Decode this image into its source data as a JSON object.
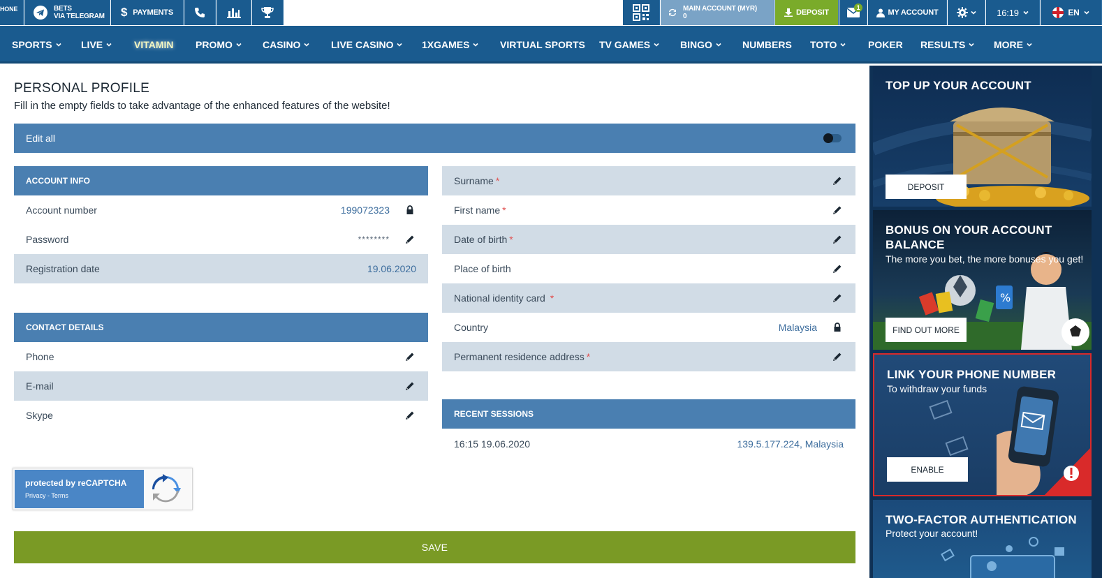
{
  "topbar": {
    "phone_label": "HONE",
    "telegram_line1": "BETS",
    "telegram_line2": "VIA TELEGRAM",
    "payments": "PAYMENTS",
    "main_account_line1": "MAIN ACCOUNT (MYR)",
    "main_account_line2": "0",
    "deposit": "DEPOSIT",
    "mail_badge": "1",
    "my_account": "MY ACCOUNT",
    "time": "16:19",
    "lang": "EN"
  },
  "nav": {
    "items": [
      "SPORTS",
      "LIVE",
      "VITAMIN",
      "PROMO",
      "CASINO",
      "LIVE CASINO",
      "1XGAMES",
      "VIRTUAL SPORTS",
      "TV GAMES",
      "BINGO",
      "NUMBERS",
      "TOTO",
      "POKER",
      "RESULTS",
      "MORE"
    ]
  },
  "profile": {
    "title": "PERSONAL PROFILE",
    "subtitle": "Fill in the empty fields to take advantage of the enhanced features of the website!",
    "edit_all": "Edit all"
  },
  "account_info": {
    "heading": "ACCOUNT INFO",
    "account_number_label": "Account number",
    "account_number": "199072323",
    "password_label": "Password",
    "password": "********",
    "registration_label": "Registration date",
    "registration_date": "19.06.2020"
  },
  "contact": {
    "heading": "CONTACT DETAILS",
    "phone": "Phone",
    "email": "E-mail",
    "skype": "Skype"
  },
  "personal": {
    "surname": "Surname",
    "first_name": "First name",
    "dob": "Date of birth",
    "place_of_birth": "Place of birth",
    "national_id": "National identity card",
    "country_label": "Country",
    "country": "Malaysia",
    "address": "Permanent residence address",
    "required_mark": "*"
  },
  "sessions": {
    "heading": "RECENT SESSIONS",
    "time": "16:15 19.06.2020",
    "ip": "139.5.177.224, Malaysia"
  },
  "captcha": {
    "line1": "protected by reCAPTCHA",
    "line2": "Privacy - Terms"
  },
  "save": "SAVE",
  "sidebar": {
    "topup_title": "TOP UP YOUR ACCOUNT",
    "topup_button": "DEPOSIT",
    "bonus_title": "BONUS ON YOUR ACCOUNT BALANCE",
    "bonus_sub": "The more you bet, the more bonuses you get!",
    "bonus_button": "FIND OUT MORE",
    "phone_title": "LINK YOUR PHONE NUMBER",
    "phone_sub": "To withdraw your funds",
    "phone_button": "ENABLE",
    "twofa_title": "TWO-FACTOR AUTHENTICATION",
    "twofa_sub": "Protect your account!"
  },
  "colors": {
    "brand_blue": "#1a5b8f",
    "section_blue": "#4a7fb1",
    "alt_row": "#d1dce6",
    "deposit_green": "#7aab2a",
    "save_green": "#7a9a25"
  }
}
